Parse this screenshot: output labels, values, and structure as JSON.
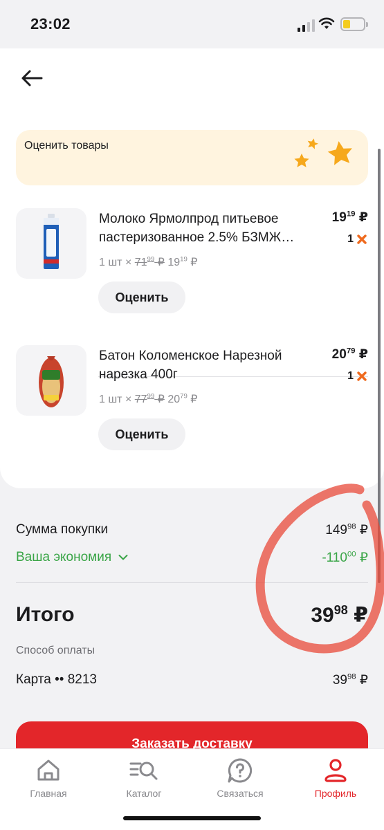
{
  "status_bar": {
    "time": "23:02"
  },
  "rate_banner": {
    "label": "Оценить товары"
  },
  "items": [
    {
      "name": "Молоко Ярмолпрод питьевое пастеризованное 2.5% БЗМЖ…",
      "qty_prefix": "1 шт ×",
      "old_price_int": "71",
      "old_price_frac": "99",
      "new_price_int": "19",
      "new_price_frac": "19",
      "price_int": "19",
      "price_frac": "19",
      "count": "1",
      "rate_label": "Оценить"
    },
    {
      "name": "Батон Коломенское Нарезной нарезка 400г",
      "qty_prefix": "1 шт ×",
      "old_price_int": "77",
      "old_price_frac": "99",
      "new_price_int": "20",
      "new_price_frac": "79",
      "price_int": "20",
      "price_frac": "79",
      "count": "1",
      "rate_label": "Оценить"
    }
  ],
  "currency": "₽",
  "summary": {
    "purchase_label": "Сумма покупки",
    "purchase_int": "149",
    "purchase_frac": "98",
    "economy_label": "Ваша экономия",
    "economy_int": "-110",
    "economy_frac": "00",
    "total_label": "Итого",
    "total_int": "39",
    "total_frac": "98",
    "payment_label": "Способ оплаты",
    "card_label": "Карта •• 8213",
    "card_int": "39",
    "card_frac": "98"
  },
  "order_button": "Заказать доставку",
  "tabs": [
    {
      "label": "Главная",
      "icon": "home-icon"
    },
    {
      "label": "Каталог",
      "icon": "catalog-search-icon"
    },
    {
      "label": "Связаться",
      "icon": "help-chat-icon"
    },
    {
      "label": "Профиль",
      "icon": "profile-icon",
      "active": true
    }
  ],
  "colors": {
    "accent": "#e3262a",
    "economy": "#3aa547",
    "banner": "#fff4df",
    "star": "#f6a81c"
  }
}
